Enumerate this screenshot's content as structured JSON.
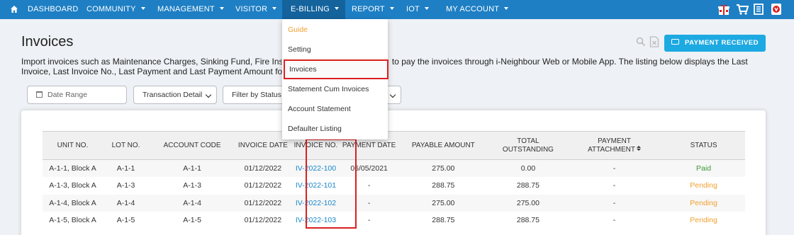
{
  "nav": {
    "items": [
      {
        "label": "DASHBOARD",
        "caret": false
      },
      {
        "label": "COMMUNITY",
        "caret": true
      },
      {
        "label": "MANAGEMENT",
        "caret": true
      },
      {
        "label": "VISITOR",
        "caret": true
      },
      {
        "label": "E-BILLING",
        "caret": true,
        "active": true
      },
      {
        "label": "REPORT",
        "caret": true
      },
      {
        "label": "IOT",
        "caret": true
      },
      {
        "label": "MY ACCOUNT",
        "caret": true
      }
    ],
    "color": "#1e7fc4",
    "right_icons": [
      "gift-box-icon",
      "cart-icon",
      "document-icon",
      "notification-icon"
    ]
  },
  "dropdown": {
    "items": [
      "Guide",
      "Setting",
      "Invoices",
      "Statement Cum Invoices",
      "Account Statement",
      "Defaulter Listing"
    ],
    "selected": "Invoices"
  },
  "page": {
    "title": "Invoices",
    "description": "Import invoices such as Maintenance Charges, Sinking Fund, Fire Ins                                              to pay the invoices through i-Neighbour Web or Mobile App. The listing below displays the Last Invoice, Last Invoice No., Last Payment and Last Payment Amount fo",
    "payment_button": "PAYMENT RECEIVED",
    "accent_color": "#1da9e1"
  },
  "filters": {
    "date_range_placeholder": "Date Range",
    "transaction_select": "Transaction Detail",
    "status_select": "Filter by Status"
  },
  "table": {
    "headers": [
      "UNIT NO.",
      "LOT NO.",
      "ACCOUNT CODE",
      "INVOICE DATE",
      "INVOICE NO.",
      "PAYMENT DATE",
      "PAYABLE AMOUNT",
      "TOTAL OUTSTANDING",
      "PAYMENT ATTACHMENT",
      "STATUS"
    ],
    "rows": [
      {
        "unit": "A-1-1, Block A",
        "lot": "A-1-1",
        "account": "A-1-1",
        "invoice_date": "01/12/2022",
        "invoice_no": "IV-2022-100",
        "payment_date": "06/05/2021",
        "payable": "275.00",
        "outstanding": "0.00",
        "attachment": "-",
        "status": "Paid"
      },
      {
        "unit": "A-1-3, Block A",
        "lot": "A-1-3",
        "account": "A-1-3",
        "invoice_date": "01/12/2022",
        "invoice_no": "IV-2022-101",
        "payment_date": "-",
        "payable": "288.75",
        "outstanding": "288.75",
        "attachment": "-",
        "status": "Pending"
      },
      {
        "unit": "A-1-4, Block A",
        "lot": "A-1-4",
        "account": "A-1-4",
        "invoice_date": "01/12/2022",
        "invoice_no": "IV-2022-102",
        "payment_date": "-",
        "payable": "275.00",
        "outstanding": "275.00",
        "attachment": "-",
        "status": "Pending"
      },
      {
        "unit": "A-1-5, Block A",
        "lot": "A-1-5",
        "account": "A-1-5",
        "invoice_date": "01/12/2022",
        "invoice_no": "IV-2022-103",
        "payment_date": "-",
        "payable": "288.75",
        "outstanding": "288.75",
        "attachment": "-",
        "status": "Pending"
      }
    ]
  }
}
